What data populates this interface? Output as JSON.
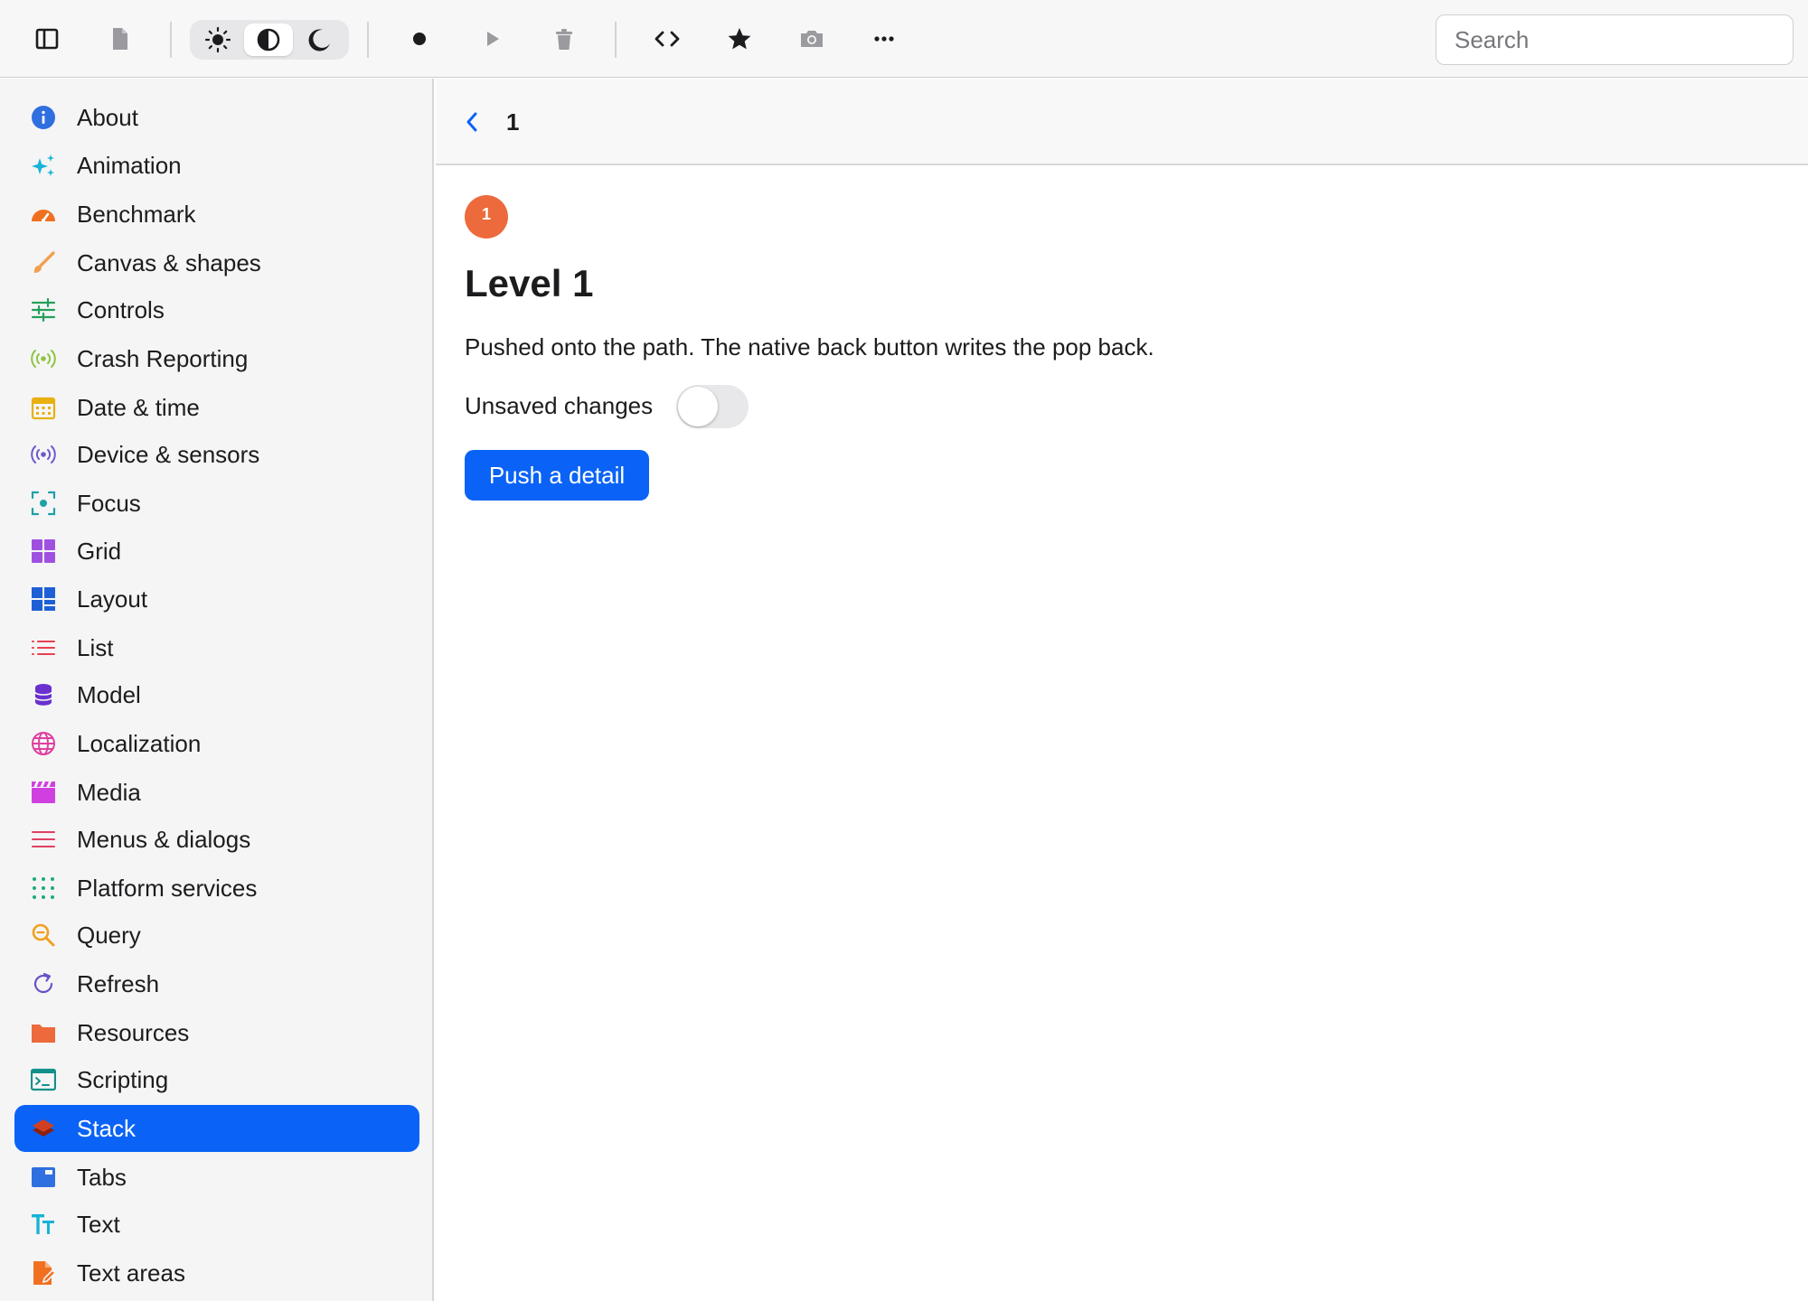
{
  "toolbar": {
    "search_placeholder": "Search",
    "icons": [
      "sidebar-toggle-icon",
      "document-icon",
      "sun-icon",
      "contrast-icon",
      "moon-icon",
      "record-icon",
      "play-icon",
      "trash-icon",
      "code-icon",
      "star-icon",
      "camera-icon",
      "more-icon"
    ],
    "appearance_selected": "auto"
  },
  "sidebar": {
    "items": [
      {
        "label": "About",
        "icon": "info-icon",
        "color": "#2f6fe0"
      },
      {
        "label": "Animation",
        "icon": "sparkles-icon",
        "color": "#17b3d6"
      },
      {
        "label": "Benchmark",
        "icon": "gauge-icon",
        "color": "#f07020"
      },
      {
        "label": "Canvas & shapes",
        "icon": "paintbrush-icon",
        "color": "#f0a050"
      },
      {
        "label": "Controls",
        "icon": "sliders-icon",
        "color": "#25a05a"
      },
      {
        "label": "Crash Reporting",
        "icon": "broadcast-icon",
        "color": "#8cc63f"
      },
      {
        "label": "Date & time",
        "icon": "calendar-icon",
        "color": "#e8b010"
      },
      {
        "label": "Device & sensors",
        "icon": "sensor-icon",
        "color": "#6a5acd"
      },
      {
        "label": "Focus",
        "icon": "focus-icon",
        "color": "#20a0a8"
      },
      {
        "label": "Grid",
        "icon": "grid-icon",
        "color": "#a050e0"
      },
      {
        "label": "Layout",
        "icon": "layout-icon",
        "color": "#1f5fd6"
      },
      {
        "label": "List",
        "icon": "list-icon",
        "color": "#e84050"
      },
      {
        "label": "Model",
        "icon": "database-icon",
        "color": "#6a30d0"
      },
      {
        "label": "Localization",
        "icon": "globe-icon",
        "color": "#e040a0"
      },
      {
        "label": "Media",
        "icon": "clapper-icon",
        "color": "#d040e0"
      },
      {
        "label": "Menus & dialogs",
        "icon": "menu-icon",
        "color": "#e04060"
      },
      {
        "label": "Platform services",
        "icon": "dots-grid-icon",
        "color": "#20a878"
      },
      {
        "label": "Query",
        "icon": "search-magnifier-icon",
        "color": "#f0a020"
      },
      {
        "label": "Refresh",
        "icon": "refresh-icon",
        "color": "#6a50c8"
      },
      {
        "label": "Resources",
        "icon": "folder-icon",
        "color": "#ec6a3c"
      },
      {
        "label": "Scripting",
        "icon": "terminal-icon",
        "color": "#14908a"
      },
      {
        "label": "Stack",
        "icon": "stack-icon",
        "color": "#d04020"
      },
      {
        "label": "Tabs",
        "icon": "tabs-icon",
        "color": "#2f6fe0"
      },
      {
        "label": "Text",
        "icon": "text-size-icon",
        "color": "#17b3d6"
      },
      {
        "label": "Text areas",
        "icon": "document-edit-icon",
        "color": "#f07020"
      }
    ],
    "selected": "Stack",
    "selected_color": "#0a63f6"
  },
  "detail": {
    "nav_title": "1",
    "badge": "1",
    "heading": "Level 1",
    "description": "Pushed onto the path. The native back button writes the pop back.",
    "toggle_label": "Unsaved changes",
    "toggle_on": false,
    "push_button": "Push a detail",
    "accent": "#0a63f6",
    "badge_color": "#ec6a3c"
  }
}
